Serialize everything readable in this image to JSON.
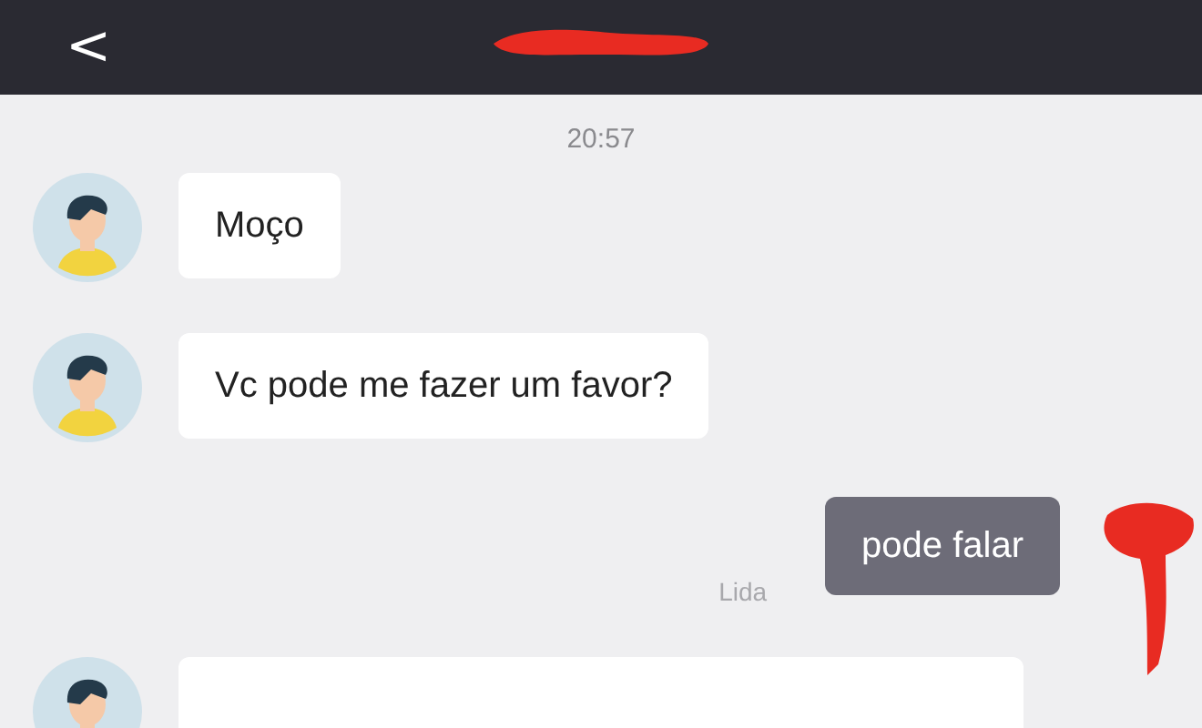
{
  "header": {
    "back_icon": "<"
  },
  "timestamp": "20:57",
  "messages": [
    {
      "kind": "incoming",
      "text": "Moço"
    },
    {
      "kind": "incoming",
      "text": "Vc pode me fazer um favor?"
    },
    {
      "kind": "outgoing",
      "text": "pode falar",
      "status": "Lida"
    },
    {
      "kind": "incoming"
    }
  ]
}
